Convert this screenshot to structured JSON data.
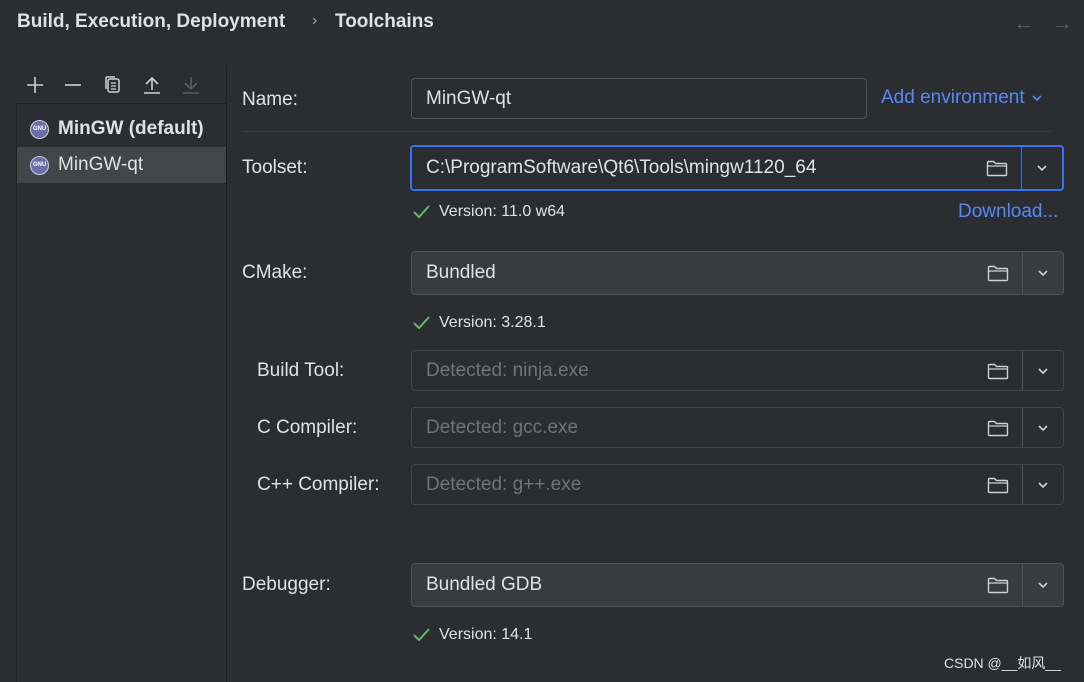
{
  "breadcrumb": {
    "parent": "Build, Execution, Deployment",
    "separator": "›",
    "current": "Toolchains"
  },
  "nav": {
    "back": "←",
    "forward": "→"
  },
  "toolbar": {
    "add": "add-icon",
    "remove": "remove-icon",
    "copy": "copy-icon",
    "move_up": "move-up-icon",
    "move_down": "move-down-icon"
  },
  "toolchains": [
    {
      "label": "MinGW (default)",
      "icon": "gnu-icon",
      "icon_text": "GNU",
      "bold": true,
      "selected": false
    },
    {
      "label": "MinGW-qt",
      "icon": "gnu-icon",
      "icon_text": "GNU",
      "bold": false,
      "selected": true
    }
  ],
  "form": {
    "name": {
      "label": "Name:",
      "value": "MinGW-qt"
    },
    "add_environment": "Add environment",
    "toolset": {
      "label": "Toolset:",
      "value": "C:\\ProgramSoftware\\Qt6\\Tools\\mingw1120_64",
      "version": "Version: 11.0 w64",
      "download": "Download..."
    },
    "cmake": {
      "label": "CMake:",
      "value": "Bundled",
      "version": "Version: 3.28.1"
    },
    "build_tool": {
      "label": "Build Tool:",
      "placeholder": "Detected: ninja.exe"
    },
    "c_compiler": {
      "label": "C Compiler:",
      "placeholder": "Detected: gcc.exe"
    },
    "cpp_compiler": {
      "label": "C++ Compiler:",
      "placeholder": "Detected: g++.exe"
    },
    "debugger": {
      "label": "Debugger:",
      "value": "Bundled GDB",
      "version": "Version: 14.1"
    }
  },
  "watermark": "CSDN @__如风__",
  "colors": {
    "background": "#2b2d30",
    "accent": "#3574f0",
    "link": "#548af7",
    "success": "#5fb865",
    "selection": "#43454a"
  }
}
